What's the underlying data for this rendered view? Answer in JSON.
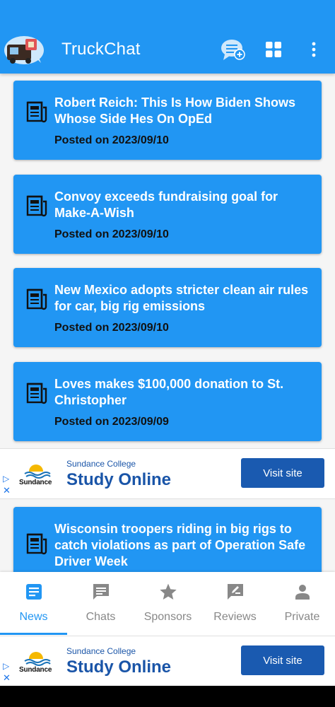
{
  "app": {
    "title": "TruckChat"
  },
  "colors": {
    "primary": "#2196f3",
    "ad_blue": "#1a55a8",
    "nav_inactive": "#888888"
  },
  "toolbar": {
    "actions": [
      {
        "name": "new-chat",
        "icon": "chat-bubble-plus-icon"
      },
      {
        "name": "grid",
        "icon": "grid-icon"
      },
      {
        "name": "more",
        "icon": "more-vert-icon"
      }
    ]
  },
  "news": [
    {
      "title": "Robert Reich: This Is How Biden Shows Whose Side Hes On  OpEd",
      "date": "Posted on 2023/09/10"
    },
    {
      "title": "Convoy exceeds fundraising goal for Make-A-Wish",
      "date": "Posted on 2023/09/10"
    },
    {
      "title": "New Mexico adopts stricter clean air rules for car, big rig emissions",
      "date": "Posted on 2023/09/10"
    },
    {
      "title": "Loves makes $100,000 donation to St. Christopher",
      "date": "Posted on 2023/09/09"
    },
    {
      "title": "Wisconsin troopers riding in big rigs to catch violations as part of Operation Safe Driver Week",
      "date": ""
    }
  ],
  "ad": {
    "sponsor": "Sundance College",
    "headline": "Study Online",
    "button": "Visit site",
    "brand": "Sundance"
  },
  "nav": {
    "items": [
      {
        "label": "News",
        "icon": "news-icon",
        "active": true
      },
      {
        "label": "Chats",
        "icon": "chat-icon",
        "active": false
      },
      {
        "label": "Sponsors",
        "icon": "star-icon",
        "active": false
      },
      {
        "label": "Reviews",
        "icon": "review-icon",
        "active": false
      },
      {
        "label": "Private",
        "icon": "person-icon",
        "active": false
      }
    ]
  }
}
